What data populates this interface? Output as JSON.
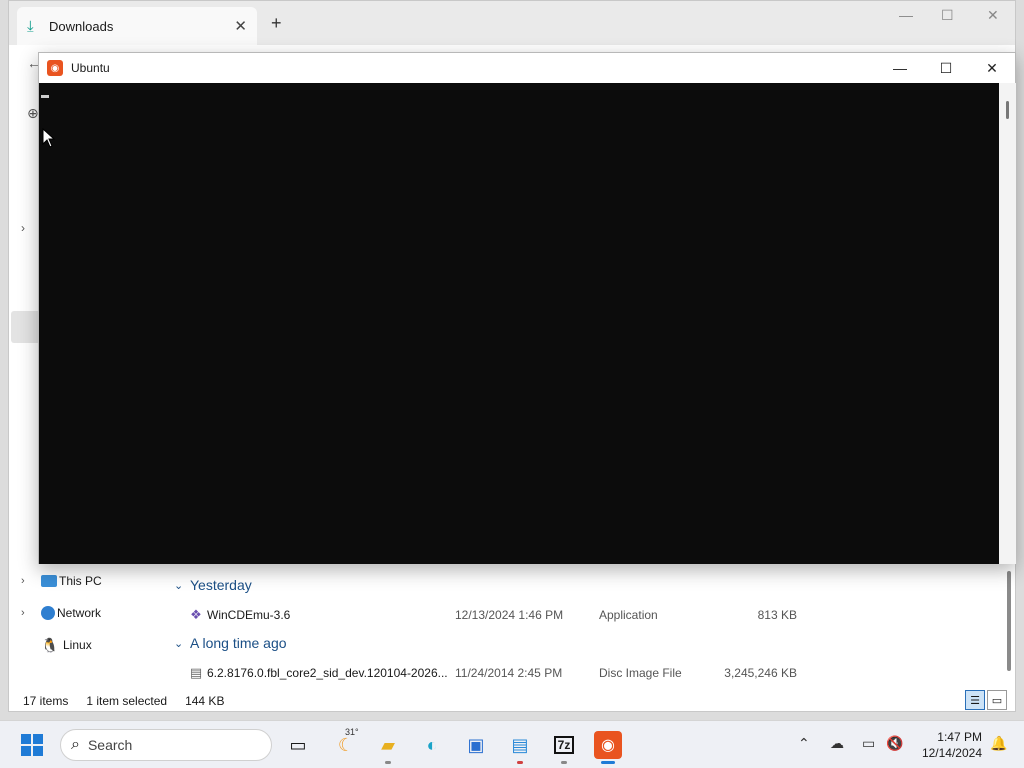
{
  "explorer": {
    "tab_title": "Downloads",
    "icons": {
      "download": "download-icon",
      "close": "close-icon",
      "new_tab": "plus-icon"
    },
    "window_controls": {
      "minimize": "—",
      "maximize": "☐",
      "close": "✕"
    },
    "sidebar": [
      {
        "label": "This PC",
        "icon": "computer-icon"
      },
      {
        "label": "Network",
        "icon": "network-icon"
      },
      {
        "label": "Linux",
        "icon": "linux-tux-icon"
      }
    ],
    "groups": [
      {
        "label": "Yesterday",
        "files": [
          {
            "name": "WinCDEmu-3.6",
            "date": "12/13/2024 1:46 PM",
            "type": "Application",
            "size": "813 KB",
            "icon": "app-installer-icon"
          }
        ]
      },
      {
        "label": "A long time ago",
        "files": [
          {
            "name": "6.2.8176.0.fbl_core2_sid_dev.120104-2026...",
            "date": "11/24/2014 2:45 PM",
            "type": "Disc Image File",
            "size": "3,245,246 KB",
            "icon": "disc-image-icon"
          }
        ]
      }
    ],
    "status": {
      "items": "17 items",
      "selected": "1 item selected",
      "size": "144 KB"
    }
  },
  "ubuntu": {
    "title": "Ubuntu",
    "controls": {
      "minimize": "—",
      "maximize": "☐",
      "close": "✕"
    }
  },
  "taskbar": {
    "search_label": "Search",
    "weather_temp": "31°",
    "time": "1:47 PM",
    "date": "12/14/2024"
  },
  "colors": {
    "ubuntu_orange": "#e95420",
    "terminal_bg": "#0c0c0c",
    "accent": "#1f7bd6",
    "group_blue": "#1b4f86"
  }
}
